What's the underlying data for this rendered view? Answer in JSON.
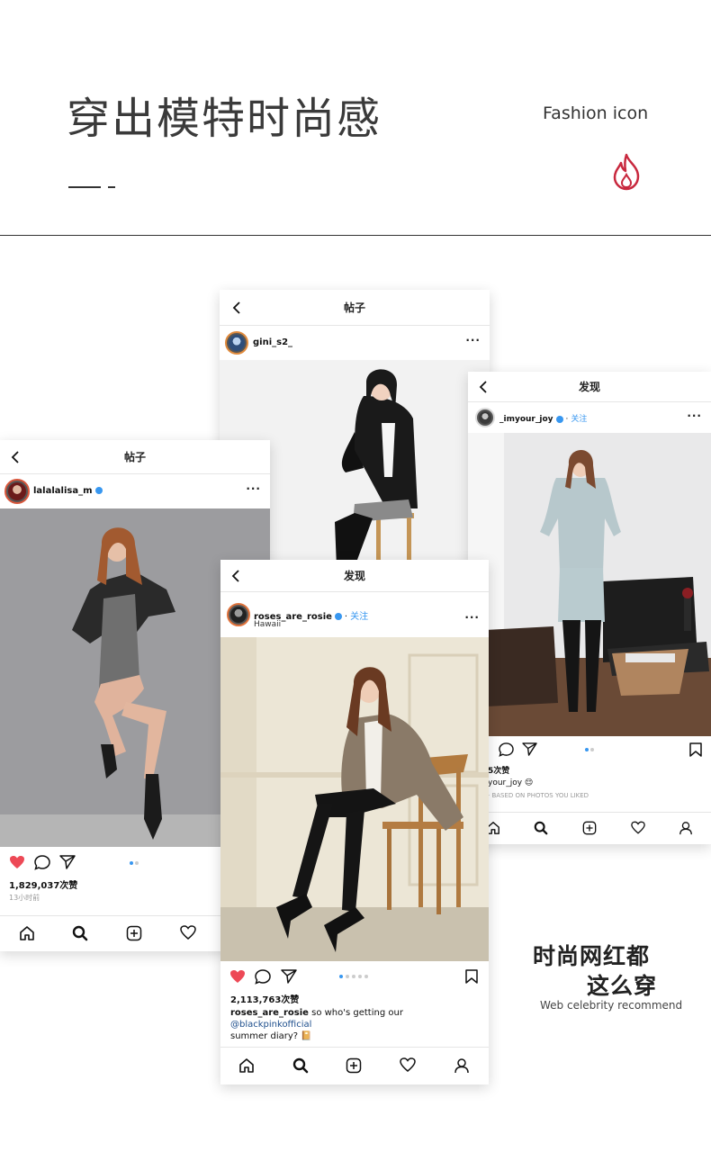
{
  "header": {
    "title": "穿出模特时尚感",
    "subtitle": "Fashion icon"
  },
  "posts": [
    {
      "screen_title": "帖子",
      "username": "gini_s2_",
      "verified": false
    },
    {
      "screen_title": "帖子",
      "username": "lalalalisa_m",
      "verified": true,
      "likes": "1,829,037次赞",
      "time": "13小时前",
      "liked": true
    },
    {
      "screen_title": "发现",
      "username": "_imyour_joy",
      "verified": true,
      "follow": "关注",
      "likes_partial": "5次赞",
      "caption_partial": "your_joy 😌",
      "suggestion_partial": "· BASED ON PHOTOS YOU LIKED"
    },
    {
      "screen_title": "发现",
      "username": "roses_are_rosie",
      "verified": true,
      "follow": "关注",
      "location": "Hawaii",
      "likes": "2,113,763次赞",
      "caption_user": "roses_are_rosie",
      "caption_text": "so who's getting our",
      "caption_tag": "@blackpinkofficial",
      "caption_line2": "summer diary? 📔",
      "liked": true
    }
  ],
  "icons": [
    "back-chevron-icon",
    "more-icon",
    "heart-icon",
    "comment-icon",
    "share-icon",
    "bookmark-icon",
    "home-icon",
    "search-icon",
    "add-icon",
    "activity-icon",
    "profile-icon",
    "flame-icon"
  ],
  "colors": {
    "accent_red": "#c8283e",
    "ig_blue": "#3897f0",
    "heart_red": "#ed4956"
  },
  "tagline": {
    "line1": "时尚网红都",
    "line2": "这么穿",
    "english": "Web celebrity recommend"
  }
}
